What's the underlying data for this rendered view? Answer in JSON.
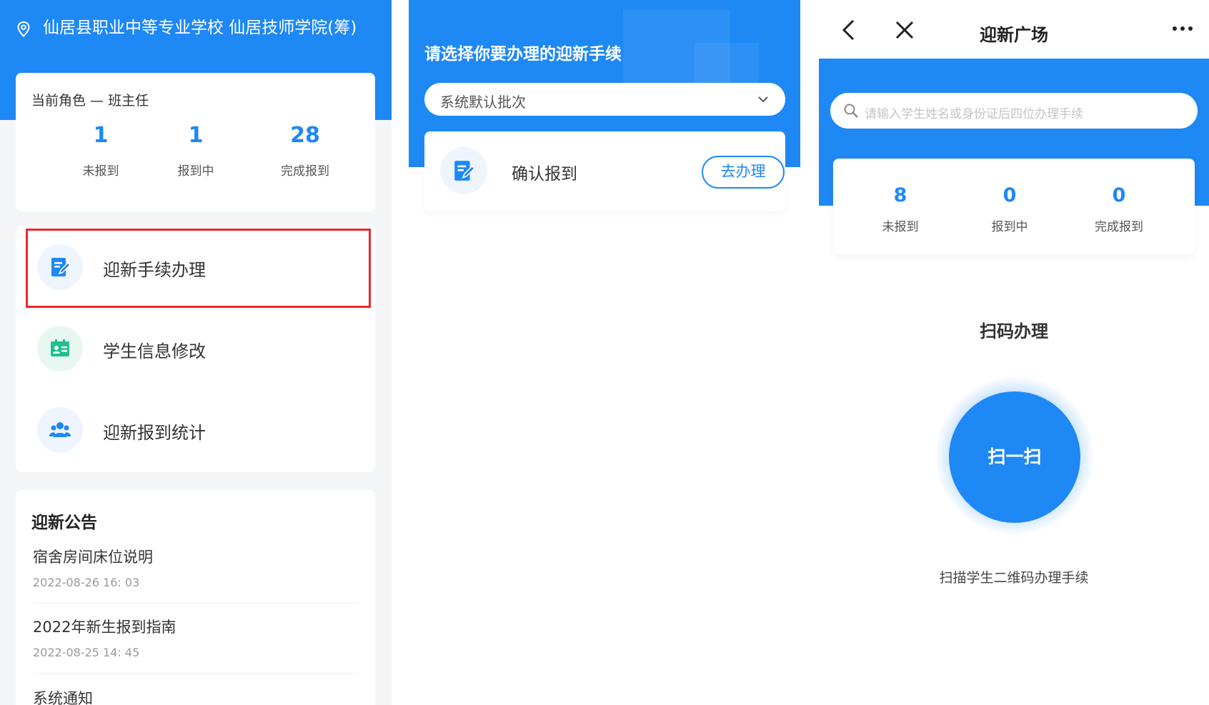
{
  "colors": {
    "primary": "#1e88f5",
    "highlight": "#e8282d",
    "teal": "#21c08e"
  },
  "panel1": {
    "school_name": "仙居县职业中等专业学校 仙居技师学院(筹)",
    "role": "当前角色 — 班主任",
    "stats": [
      {
        "value": "1",
        "label": "未报到"
      },
      {
        "value": "1",
        "label": "报到中"
      },
      {
        "value": "28",
        "label": "完成报到"
      }
    ],
    "menu": [
      {
        "label": "迎新手续办理",
        "icon": "edit-form-icon"
      },
      {
        "label": "学生信息修改",
        "icon": "id-card-icon"
      },
      {
        "label": "迎新报到统计",
        "icon": "group-users-icon"
      }
    ],
    "notice": {
      "title": "迎新公告",
      "items": [
        {
          "title": "宿舍房间床位说明",
          "time": "2022-08-26 16: 03"
        },
        {
          "title": "2022年新生报到指南",
          "time": "2022-08-25 14: 45"
        },
        {
          "title": "系统通知",
          "time": ""
        }
      ]
    }
  },
  "panel2": {
    "title": "请选择你要办理的迎新手续",
    "batch_select": "系统默认批次",
    "task": {
      "label": "确认报到",
      "button": "去办理",
      "icon": "edit-form-icon"
    }
  },
  "panel3": {
    "nav_title": "迎新广场",
    "search_placeholder": "请输入学生姓名或身份证后四位办理手续",
    "stats": [
      {
        "value": "8",
        "label": "未报到"
      },
      {
        "value": "0",
        "label": "报到中"
      },
      {
        "value": "0",
        "label": "完成报到"
      }
    ],
    "scan_title": "扫码办理",
    "scan_button": "扫一扫",
    "scan_desc": "扫描学生二维码办理手续"
  }
}
